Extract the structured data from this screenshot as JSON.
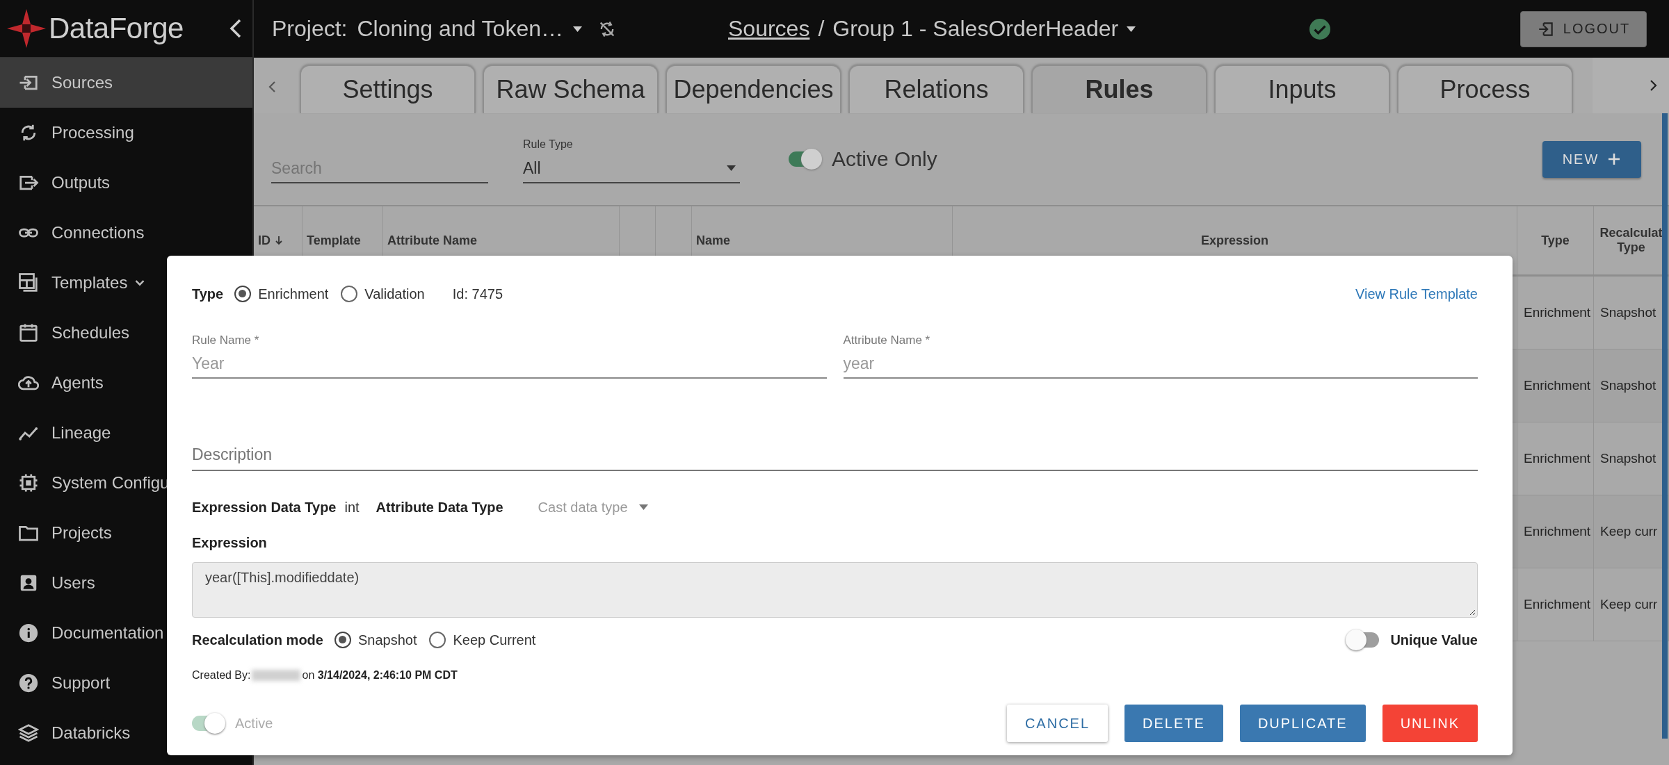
{
  "app": {
    "logo": "DataForge"
  },
  "sidebar": {
    "items": [
      {
        "label": "Sources",
        "selected": true,
        "kind": "link"
      },
      {
        "label": "Processing",
        "selected": false,
        "kind": "link"
      },
      {
        "label": "Outputs",
        "selected": false,
        "kind": "link"
      },
      {
        "label": "Connections",
        "selected": false,
        "kind": "link"
      },
      {
        "label": "Templates",
        "selected": false,
        "kind": "group"
      },
      {
        "label": "Schedules",
        "selected": false,
        "kind": "link"
      },
      {
        "label": "Agents",
        "selected": false,
        "kind": "link"
      },
      {
        "label": "Lineage",
        "selected": false,
        "kind": "link"
      },
      {
        "label": "System Configu",
        "selected": false,
        "kind": "link"
      },
      {
        "label": "Projects",
        "selected": false,
        "kind": "link"
      },
      {
        "label": "Users",
        "selected": false,
        "kind": "link"
      },
      {
        "label": "Documentation",
        "selected": false,
        "kind": "link"
      },
      {
        "label": "Support",
        "selected": false,
        "kind": "link"
      },
      {
        "label": "Databricks",
        "selected": false,
        "kind": "link"
      }
    ]
  },
  "header": {
    "project_label": "Project:",
    "project_name": "Cloning and Token…",
    "breadcrumb_link": "Sources",
    "separator": "/",
    "current": "Group 1 - SalesOrderHeader",
    "logout": "LOGOUT"
  },
  "tabs": [
    {
      "label": "Settings",
      "selected": false
    },
    {
      "label": "Raw Schema",
      "selected": false
    },
    {
      "label": "Dependencies",
      "selected": false
    },
    {
      "label": "Relations",
      "selected": false
    },
    {
      "label": "Rules",
      "selected": true
    },
    {
      "label": "Inputs",
      "selected": false
    },
    {
      "label": "Process",
      "selected": false
    }
  ],
  "filters": {
    "search": {
      "placeholder": "Search"
    },
    "rule_type": {
      "label": "Rule Type",
      "value": "All"
    },
    "active_only": {
      "label": "Active Only",
      "on": true
    },
    "new_button": "NEW"
  },
  "table": {
    "columns": [
      {
        "label": "ID",
        "sorted": true
      },
      {
        "label": "Template",
        "sorted": false
      },
      {
        "label": "Attribute Name",
        "sorted": false
      },
      {
        "sorted": false
      },
      {
        "sorted": false
      },
      {
        "label": "Name",
        "sorted": false
      },
      {
        "label": "Expression",
        "sorted": false
      },
      {
        "label": "Type",
        "sorted": false
      },
      {
        "label": "Recalculat Type",
        "sorted": false
      }
    ],
    "rows": [
      {
        "type": "Enrichment",
        "recalculation_type": "Snapshot"
      },
      {
        "type": "Enrichment",
        "recalculation_type": "Snapshot"
      },
      {
        "type": "Enrichment",
        "recalculation_type": "Snapshot"
      },
      {
        "type": "Enrichment",
        "recalculation_type": "Keep curr"
      },
      {
        "type": "Enrichment",
        "recalculation_type": "Keep curr"
      }
    ]
  },
  "modal": {
    "type_label": "Type",
    "type_options": [
      {
        "label": "Enrichment",
        "selected": true
      },
      {
        "label": "Validation",
        "selected": false
      }
    ],
    "id_text": "Id: 7475",
    "template_link": "View Rule Template",
    "fields": [
      {
        "label": "Rule Name *",
        "value": "Year",
        "disabled": true
      },
      {
        "label": "Attribute Name *",
        "value": "year",
        "disabled": true
      }
    ],
    "description": {
      "placeholder": "Description"
    },
    "expression_data_type_label": "Expression Data Type",
    "expression_data_type": "int",
    "attribute_data_type_label": "Attribute Data Type",
    "attribute_data_type": {
      "placeholder": "Cast data type"
    },
    "expression_label": "Expression",
    "expression": "year([This].modifieddate)",
    "recalculation_label": "Recalculation mode",
    "recalculation_options": [
      {
        "label": "Snapshot",
        "selected": true
      },
      {
        "label": "Keep Current",
        "selected": false
      }
    ],
    "unique_value": {
      "label": "Unique Value",
      "on": false
    },
    "created_by_label": "Created By:",
    "created_on": "on **3/14/2024, 2:46:10 PM CDT**",
    "active": {
      "label": "Active",
      "on": true,
      "disabled": true
    },
    "buttons": [
      {
        "label": "CANCEL",
        "kind": "outline"
      },
      {
        "label": "DELETE",
        "kind": "primary"
      },
      {
        "label": "DUPLICATE",
        "kind": "primary"
      },
      {
        "label": "UNLINK",
        "kind": "danger"
      }
    ]
  }
}
